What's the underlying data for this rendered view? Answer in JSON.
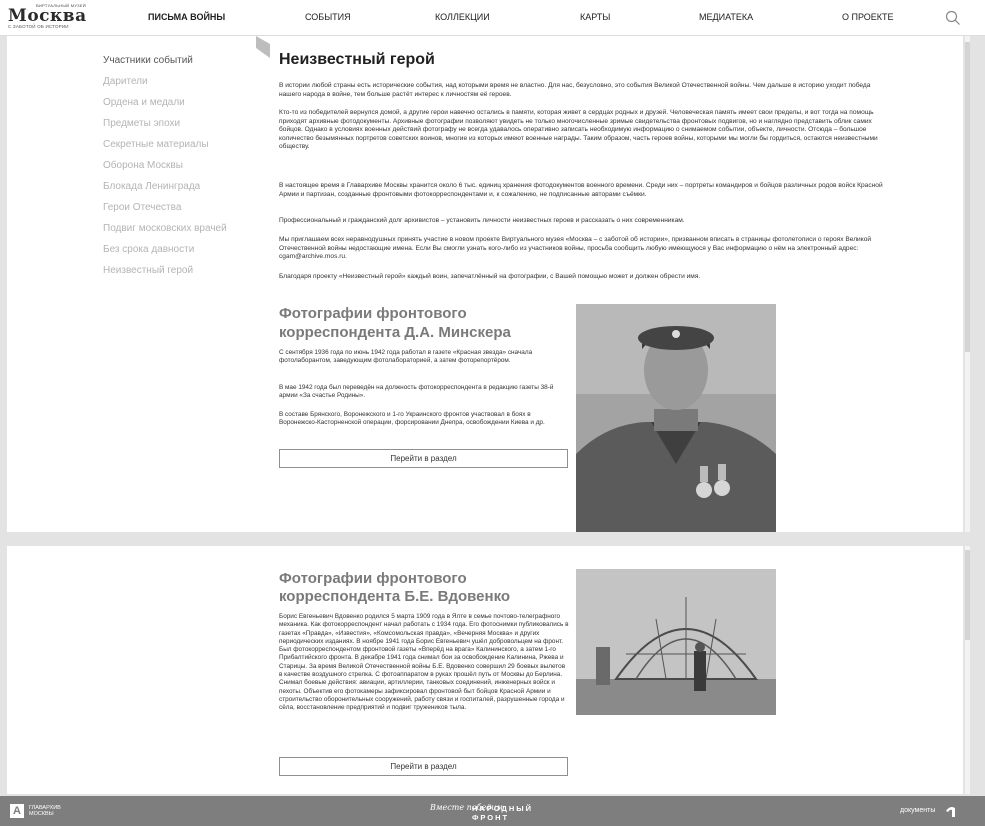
{
  "logo": {
    "top": "Виртуальный музей",
    "main": "Москва",
    "sub": "С заботой об истории"
  },
  "nav": [
    "Письма войны",
    "События",
    "Коллекции",
    "Карты",
    "Медиатека",
    "О проекте"
  ],
  "sidebar": [
    "Участники событий",
    "Дарители",
    "Ордена и медали",
    "Предметы эпохи",
    "Секретные материалы",
    "Оборона Москвы",
    "Блокада Ленинграда",
    "Герои Отечества",
    "Подвиг московских врачей",
    "Без срока давности",
    "Неизвестный герой"
  ],
  "article": {
    "title": "Неизвестный герой",
    "paragraphs": [
      "В истории любой страны есть исторические события, над которыми время не властно. Для нас, безусловно, это события Великой Отечественной войны. Чем дальше в историю уходит победа нашего народа в войне, тем больше растёт интерес к личностям её героев.",
      "Кто-то из победителей вернулся домой, а другие герои навечно остались в памяти, которая живет в сердцах родных и друзей. Человеческая память имеет свои пределы, и вот тогда на помощь приходят архивные фотодокументы. Архивные фотографии позволяют увидеть не только многочисленные зримые свидетельства фронтовых подвигов, но и наглядно представить облик самих бойцов. Однако в условиях военных действий фотографу не всегда удавалось оперативно записать необходимую информацию о снимаемом событии, объекте, личности. Отсюда – большое количество безымянных портретов советских воинов, многие из которых имеют военные награды. Таким образом, часть героев войны, которыми мы могли бы гордиться, остаются неизвестными обществу.",
      "В настоящее время в Главархиве Москвы хранится около 6 тыс. единиц хранения фотодокументов военного времени. Среди них – портреты командиров и бойцов различных родов войск Красной Армии и партизан, созданные фронтовыми фотокорреспондентами и, к сожалению, не подписанные авторами съёмки.",
      "Профессиональный и гражданский долг архивистов – установить личности неизвестных героев и рассказать о них современникам.",
      "Мы приглашаем всех неравнодушных принять участие в новом проекте Виртуального музея «Москва – с заботой об истории», призванном вписать в страницы фотолетописи о героях Великой Отечественной войны недостающие имена. Если Вы смогли узнать кого-либо из участников войны, просьба сообщить любую имеющуюся у Вас информацию о нём на электронный адрес: cgam@archive.mos.ru.",
      "Благодаря проекту «Неизвестный герой» каждый воин, запечатлённый на фотографии, с Вашей помощью может и должен обрести имя."
    ]
  },
  "sections": [
    {
      "title_line1": "Фотографии фронтового",
      "title_line2": "корреспондента Д.А. Минскера",
      "paragraphs": [
        "С сентября 1936 года по июнь 1942 года работал в газете «Красная звезда» сначала фотолаборантом, заведующим фотолабораторией, а затем фоторепортёром.",
        "В мае 1942 года был переведён на должность фотокорреспондента в редакцию газеты 38-й армии «За счастье Родины».",
        "В составе Брянского, Воронежского и 1-го Украинского фронтов участвовал в боях в Воронежско-Касторненской операции, форсировании Днепра, освобождении Киева и др."
      ],
      "button": "Перейти в раздел"
    },
    {
      "title_line1": "Фотографии фронтового",
      "title_line2": "корреспондента Б.Е. Вдовенко",
      "paragraphs": [
        "Борис Евгеньевич Вдовенко родился 5 марта 1909 года в Ялте в семье почтово-телеграфного механика. Как фотокорреспондент начал работать с 1934 года. Его фотоснимки публиковались в газетах «Правда», «Известия», «Комсомольская правда», «Вечерняя Москва» и других периодических изданиях. В ноябре 1941 года Борис Евгеньевич ушёл добровольцем на фронт. Был фотокорреспондентом фронтовой газеты «Вперёд на врага» Калининского, а затем 1-го Прибалтийского фронта. В декабре 1941 года снимал бои за освобождение Калинина, Ржева и Старицы. За время Великой Отечественной войны Б.Е. Вдовенко совершил 29 боевых вылетов в качестве воздушного стрелка. С фотоаппаратом в руках прошёл путь от Москвы до Берлина. Снимал боевые действия: авиации, артиллерии, танковых соединений, инженерных войск и пехоты. Объектив его фотокамеры зафиксировал фронтовой быт бойцов Красной Армии и строительство оборонительных сооружений, работу связи и госпиталей, разрушенные города и сёла, восстановление предприятий и подвиг тружеников тыла."
      ],
      "button": "Перейти в раздел"
    }
  ],
  "footer": {
    "left_mark": "А",
    "left_line1": "Главархив",
    "left_line2": "Москвы",
    "center_script": "Вместе победим",
    "center_line1": "НАРОДНЫЙ",
    "center_line2": "ФРОНТ",
    "right_text": "документы",
    "right_badge": "мои"
  }
}
